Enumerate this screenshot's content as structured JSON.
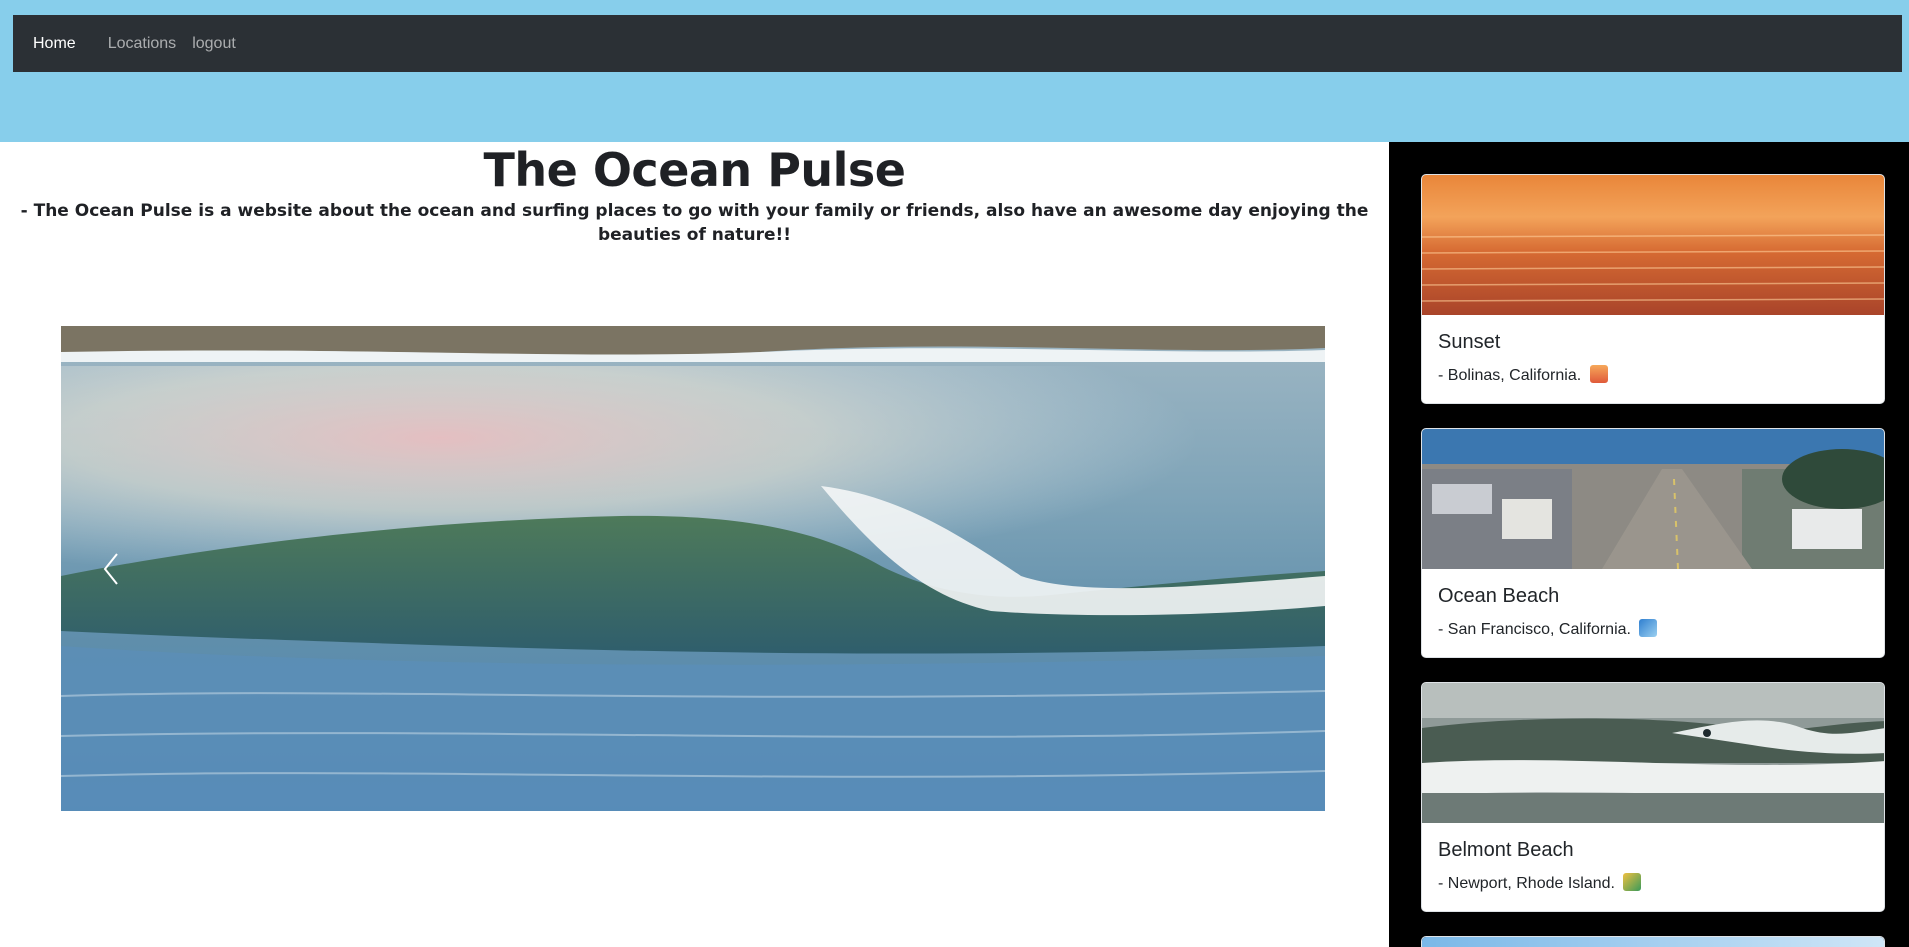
{
  "nav": {
    "items": [
      {
        "label": "Home",
        "active": true
      },
      {
        "label": "Locations",
        "active": false
      },
      {
        "label": "logout",
        "active": false
      }
    ]
  },
  "hero": {
    "title": "The Ocean Pulse",
    "subtitle": "- The Ocean Pulse is a website about the ocean and surfing places to go with your family or friends, also have an awesome day enjoying the beauties of nature!!"
  },
  "carousel": {
    "prev_icon": "chevron-left-icon"
  },
  "locations": [
    {
      "name": "Sunset",
      "description": "- Bolinas, California.",
      "emoji": "sunset-emoji"
    },
    {
      "name": "Ocean Beach",
      "description": "- San Francisco, California.",
      "emoji": "wave-emoji"
    },
    {
      "name": "Belmont Beach",
      "description": "- Newport, Rhode Island.",
      "emoji": "surfer-emoji"
    }
  ],
  "colors": {
    "page_background": "#87ceeb",
    "navbar": "#2b3035",
    "sidebar": "#000000"
  }
}
